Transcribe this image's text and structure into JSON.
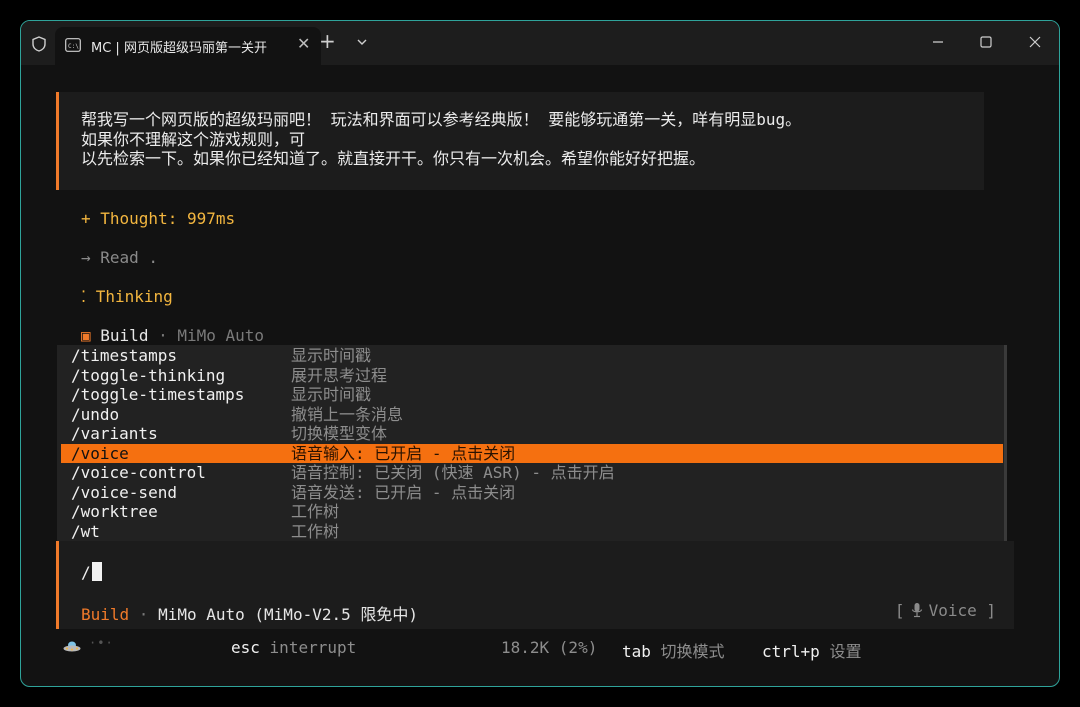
{
  "window": {
    "tab_title": "MC | 网页版超级玛丽第一关开",
    "new_tab_label": "+",
    "tab_close_label": "✕"
  },
  "colors": {
    "accent": "#f07a2a",
    "selection": "#f57010",
    "thought": "#f3b63f",
    "window_border": "#2fa39a"
  },
  "conversation": {
    "user_prompt": "帮我写一个网页版的超级玛丽吧！ 玩法和界面可以参考经典版！ 要能够玩通第一关，咩有明显bug。\n如果你不理解这个游戏规则，可\n以先检索一下。如果你已经知道了。就直接开干。你只有一次机会。希望你能好好把握。",
    "thought": "+ Thought: 997ms",
    "read": "→ Read .",
    "thinking": "⁚ Thinking",
    "build_marker": "▣",
    "build_label": "Build",
    "build_sep": " · ",
    "build_model": "MiMo Auto"
  },
  "commands": [
    {
      "name": "/timestamps",
      "desc": "显示时间戳"
    },
    {
      "name": "/toggle-thinking",
      "desc": "展开思考过程"
    },
    {
      "name": "/toggle-timestamps",
      "desc": "显示时间戳"
    },
    {
      "name": "/undo",
      "desc": "撤销上一条消息"
    },
    {
      "name": "/variants",
      "desc": "切换模型变体"
    },
    {
      "name": "/voice",
      "desc": "语音输入: 已开启 - 点击关闭",
      "selected": true
    },
    {
      "name": "/voice-control",
      "desc": "语音控制: 已关闭 (快速 ASR)  - 点击开启"
    },
    {
      "name": "/voice-send",
      "desc": "语音发送: 已开启 - 点击关闭"
    },
    {
      "name": "/worktree",
      "desc": "工作树"
    },
    {
      "name": "/wt",
      "desc": "工作树"
    }
  ],
  "input": {
    "value": "/",
    "mode": "Build",
    "sep": " · ",
    "model": "MiMo Auto (MiMo-V2.5 限免中)",
    "voice_open": "[",
    "voice_label": "Voice ]",
    "mic_icon": "microphone-icon"
  },
  "statusbar": {
    "esc_key": "esc",
    "esc_action": "interrupt",
    "tokens": "18.2K (2%)",
    "tab_key": "tab",
    "tab_action": "切换模式",
    "ctrlp_key": "ctrl+p",
    "ctrlp_action": "设置",
    "dots": "·•·"
  }
}
